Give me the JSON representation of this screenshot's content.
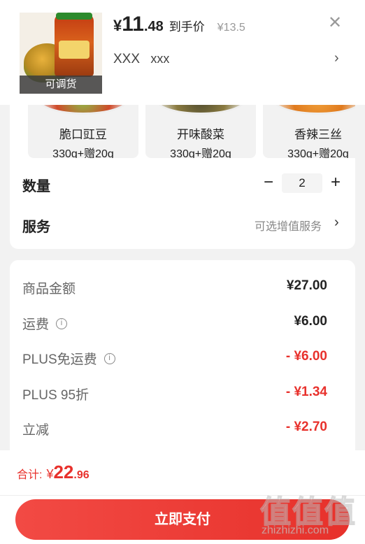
{
  "header": {
    "image_caption": "可调货",
    "price": {
      "symbol": "¥",
      "integer": "11",
      "decimal": ".48",
      "label": "到手价",
      "original": "¥13.5"
    },
    "spec": {
      "a": "XXX",
      "b": "xxx"
    },
    "close_icon": "close-icon",
    "chevron_icon": "chevron-right-icon"
  },
  "variants": [
    {
      "name": "脆口豇豆",
      "weight": "330g+赠20g"
    },
    {
      "name": "开味酸菜",
      "weight": "330g+赠20g"
    },
    {
      "name": "香辣三丝",
      "weight": "330g+赠20g"
    }
  ],
  "quantity": {
    "label": "数量",
    "minus": "−",
    "value": "2",
    "plus": "+"
  },
  "service": {
    "label": "服务",
    "value": "可选增值服务",
    "chevron": "›"
  },
  "summary": [
    {
      "label": "商品金额",
      "value": "¥27.00",
      "info": false,
      "red": false
    },
    {
      "label": "运费",
      "value": "¥6.00",
      "info": true,
      "red": false
    },
    {
      "label": "PLUS免运费",
      "value": "- ¥6.00",
      "info": true,
      "red": true
    },
    {
      "label": "PLUS 95折",
      "value": "- ¥1.34",
      "info": false,
      "red": true
    },
    {
      "label": "立减",
      "value": "- ¥2.70",
      "info": false,
      "red": true
    }
  ],
  "footer": {
    "total_label": "合计:",
    "total_symbol": "¥",
    "total_integer": "22",
    "total_decimal": ".96",
    "pay_label": "立即支付"
  },
  "watermark": {
    "glyphs": "值值值",
    "text": "zhizhizhi.com"
  },
  "colors": {
    "accent": "#e8312c",
    "background": "#f2f2f2"
  }
}
